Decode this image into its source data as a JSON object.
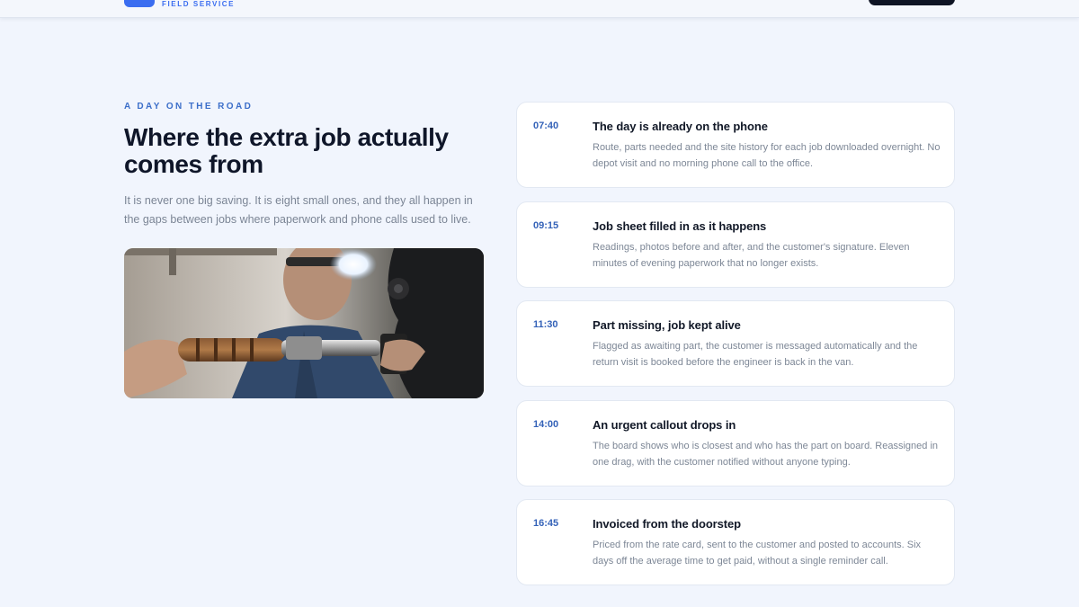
{
  "nav": {
    "logo_sub": "FIELD SERVICE"
  },
  "section": {
    "eyebrow": "A DAY ON THE ROAD",
    "headline": "Where the extra job actually comes from",
    "lead": "It is never one big saving. It is eight small ones, and they all happen in the gaps between jobs where paperwork and phone calls used to live."
  },
  "timeline": [
    {
      "time": "07:40",
      "title": "The day is already on the phone",
      "desc": "Route, parts needed and the site history for each job downloaded overnight. No depot visit and no morning phone call to the office."
    },
    {
      "time": "09:15",
      "title": "Job sheet filled in as it happens",
      "desc": "Readings, photos before and after, and the customer's signature. Eleven minutes of evening paperwork that no longer exists."
    },
    {
      "time": "11:30",
      "title": "Part missing, job kept alive",
      "desc": "Flagged as awaiting part, the customer is messaged automatically and the return visit is booked before the engineer is back in the van."
    },
    {
      "time": "14:00",
      "title": "An urgent callout drops in",
      "desc": "The board shows who is closest and who has the part on board. Reassigned in one drag, with the customer notified without anyone typing."
    },
    {
      "time": "16:45",
      "title": "Invoiced from the doorstep",
      "desc": "Priced from the rate card, sent to the customer and posted to accounts. Six days off the average time to get paid, without a single reminder call."
    }
  ],
  "colors": {
    "background": "#f1f5fd",
    "accent": "#3a6df0",
    "time_text": "#3462b8",
    "heading": "#0f1629",
    "cta_dark": "#0e1424"
  }
}
